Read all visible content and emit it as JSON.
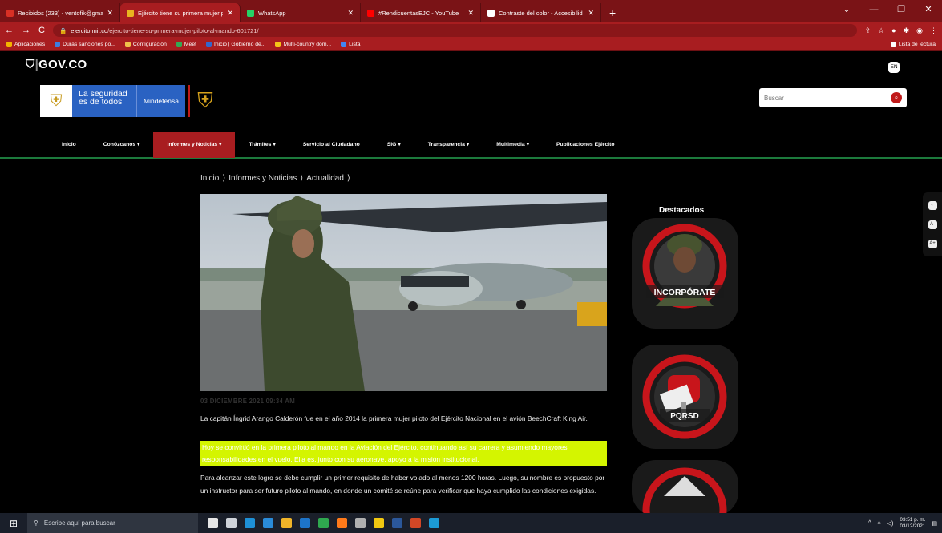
{
  "browser": {
    "tabs": [
      {
        "title": "Recibidos (233) - ventofik@gmail",
        "active": false,
        "favicon_color": "#d93025"
      },
      {
        "title": "Ejército tiene su primera mujer p",
        "active": true,
        "favicon_color": "#e9b320"
      },
      {
        "title": "WhatsApp",
        "active": false,
        "favicon_color": "#25d366"
      },
      {
        "title": "#RendicuentasEJC - YouTube",
        "active": false,
        "favicon_color": "#ff0000"
      },
      {
        "title": "Contraste del color - Accesibilid",
        "active": false,
        "favicon_color": "#ffffff"
      }
    ],
    "new_tab": "+",
    "url_domain": "ejercito.mil.co",
    "url_path": "/ejercito-tiene-su-primera-mujer-piloto-al-mando-601721/",
    "bookmarks": [
      {
        "label": "Aplicaciones",
        "color": "#f4b400"
      },
      {
        "label": "Duras sanciones po...",
        "color": "#3f7de0"
      },
      {
        "label": "Configuración",
        "color": "#f0c04a"
      },
      {
        "label": "Meet",
        "color": "#34a853"
      },
      {
        "label": "Inicio | Gobierno de...",
        "color": "#3366cc"
      },
      {
        "label": "Multi-country dom...",
        "color": "#f5c518"
      },
      {
        "label": "Lista",
        "color": "#4285f4"
      }
    ],
    "reading_list": "Lista de lectura"
  },
  "site": {
    "govco": "GOV.CO",
    "lang": "EN",
    "slogan": "La seguridad es de todos",
    "ministry": "Mindefensa",
    "search_placeholder": "Buscar",
    "nav": [
      {
        "label": "Inicio",
        "active": false
      },
      {
        "label": "Conózcanos ▾",
        "active": false
      },
      {
        "label": "Informes y Noticias ▾",
        "active": true
      },
      {
        "label": "Trámites ▾",
        "active": false
      },
      {
        "label": "Servicio al Ciudadano",
        "active": false
      },
      {
        "label": "SIG ▾",
        "active": false
      },
      {
        "label": "Transparencia ▾",
        "active": false
      },
      {
        "label": "Multimedia ▾",
        "active": false
      },
      {
        "label": "Publicaciones Ejército",
        "active": false
      }
    ],
    "breadcrumb": [
      "Inicio",
      "Informes y Noticias",
      "Actualidad"
    ],
    "article": {
      "date": "03 DICIEMBRE 2021 09:34 AM",
      "p1": "La capitán Íngrid Arango Calderón fue en el año 2014 la primera mujer piloto del Ejército Nacional en el avión BeechCraft King Air.",
      "p2": "Hoy se convirtió en la primera piloto al mando en la Aviación del Ejército, continuando así su carrera y asumiendo mayores responsabilidades en el vuelo. Ella es, junto con su aeronave, apoyo a la misión institucional.",
      "p3": "Para alcanzar este logro se debe cumplir un primer requisito de haber volado al menos 1200 horas. Luego, su nombre es propuesto por un instructor para ser futuro piloto al mando, en donde un comité se reúne para verificar que haya cumplido las condiciones exigidas."
    },
    "destacados_title": "Destacados",
    "cards": [
      "INCORPÓRATE",
      "PQRSD"
    ],
    "a11y_buttons": [
      "◐",
      "A-",
      "A+"
    ]
  },
  "taskbar": {
    "search_placeholder": "Escribe aquí para buscar",
    "time": "03:51 p. m.",
    "date": "03/12/2021",
    "app_colors": [
      "#e6e6e6",
      "#cfd3d9",
      "#1e90d6",
      "#2a8bd8",
      "#f0b429",
      "#1d74c9",
      "#2fa84f",
      "#ff7a1a",
      "#b0b0b0",
      "#f2c811",
      "#2b579a",
      "#d24726",
      "#1c9bd6"
    ]
  }
}
